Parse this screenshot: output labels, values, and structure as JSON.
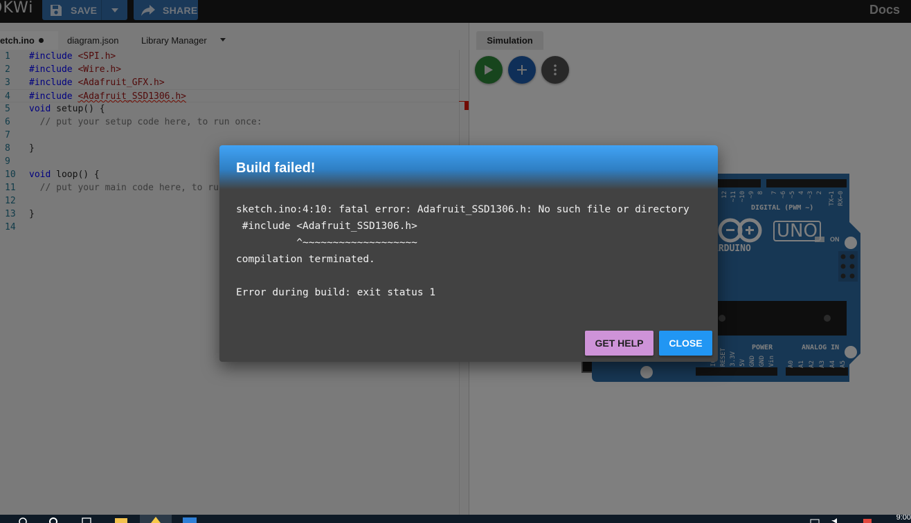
{
  "app": {
    "logo": "OKWi",
    "save_label": "SAVE",
    "share_label": "SHARE",
    "docs_label": "Docs"
  },
  "editor": {
    "tabs": [
      {
        "label": "etch.ino",
        "modified": true
      },
      {
        "label": "diagram.json"
      },
      {
        "label": "Library Manager"
      }
    ],
    "lines": [
      {
        "num": "1",
        "directive": "#include",
        "header": "<SPI.h>"
      },
      {
        "num": "2",
        "directive": "#include",
        "header": "<Wire.h>"
      },
      {
        "num": "3",
        "directive": "#include",
        "header": "<Adafruit_GFX.h>"
      },
      {
        "num": "4",
        "directive": "#include",
        "header": "<Adafruit_SSD1306.h>"
      },
      {
        "num": "5",
        "keyword": "void",
        "rest": "setup() {"
      },
      {
        "num": "6",
        "comment": "  // put your setup code here, to run once:"
      },
      {
        "num": "7"
      },
      {
        "num": "8",
        "rest": "}"
      },
      {
        "num": "9"
      },
      {
        "num": "10",
        "keyword": "void",
        "rest": "loop() {"
      },
      {
        "num": "11",
        "comment": "  // put your main code here, to run repeatedly:"
      },
      {
        "num": "12"
      },
      {
        "num": "13",
        "rest": "}"
      },
      {
        "num": "14"
      }
    ]
  },
  "simulation": {
    "tab_label": "Simulation",
    "board": {
      "brand": "ARDUINO",
      "model": "UNO",
      "on_label": "ON",
      "digital_label": "DIGITAL (PWM ~)",
      "power_label": "POWER",
      "analog_label": "ANALOG IN",
      "digital_pins": [
        "12",
        "~11",
        "~10",
        "~9",
        "8",
        "7",
        "~6",
        "~5",
        "4",
        "~3",
        "2",
        "TX→1",
        "RX←0"
      ],
      "power_pins": [
        "IOREF",
        "RESET",
        "3.3V",
        "5V",
        "GND",
        "GND",
        "Vin"
      ],
      "analog_pins": [
        "A0",
        "A1",
        "A2",
        "A3",
        "A4",
        "A5"
      ]
    }
  },
  "dialog": {
    "title": "Build failed!",
    "lines": [
      "sketch.ino:4:10: fatal error: Adafruit_SSD1306.h: No such file or directory",
      " #include <Adafruit_SSD1306.h>",
      "          ^~~~~~~~~~~~~~~~~~~~",
      "compilation terminated.",
      "",
      "Error during build: exit status 1"
    ],
    "help_label": "GET HELP",
    "close_label": "CLOSE"
  },
  "taskbar": {
    "clock": "9:00"
  }
}
